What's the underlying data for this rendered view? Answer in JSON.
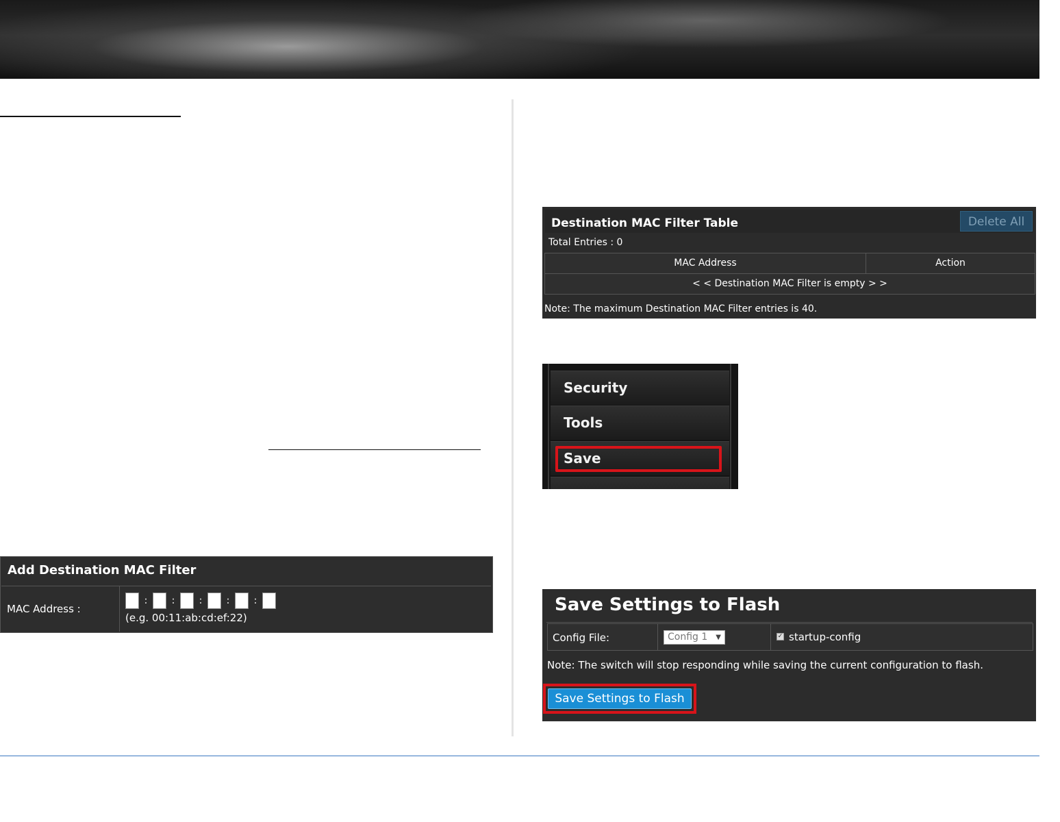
{
  "add_filter": {
    "title": "Add Destination MAC Filter",
    "mac_label": "MAC Address :",
    "separator": ":",
    "example": "(e.g. 00:11:ab:cd:ef:22)"
  },
  "filter_table": {
    "title": "Destination MAC Filter Table",
    "delete_all_label": "Delete All",
    "total_entries": "Total Entries : 0",
    "columns": [
      "MAC Address",
      "Action"
    ],
    "empty_message": "< < Destination MAC Filter is empty > >",
    "note": "Note: The maximum Destination MAC Filter entries is 40."
  },
  "menu": {
    "items": [
      "Security",
      "Tools",
      "Save"
    ],
    "highlighted": "Save"
  },
  "save_flash": {
    "title": "Save Settings to Flash",
    "config_label": "Config File:",
    "config_selected": "Config 1",
    "checkbox_label": "startup-config",
    "checkbox_checked": true,
    "note": "Note: The switch will stop responding while saving the current configuration to flash.",
    "button_label": "Save Settings to Flash"
  },
  "colors": {
    "highlight_red": "#d8141a",
    "button_blue": "#1a8fd6",
    "panel_dark": "#2c2c2c",
    "footer_line": "#3a78c0"
  }
}
